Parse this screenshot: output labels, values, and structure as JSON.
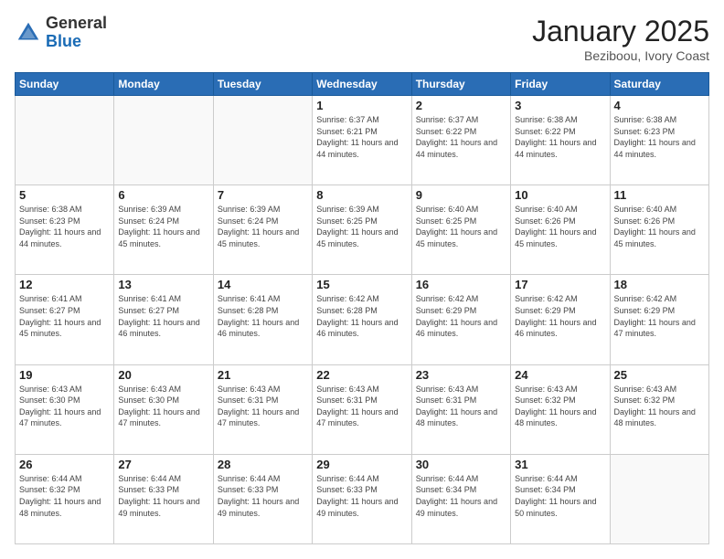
{
  "header": {
    "logo": {
      "general": "General",
      "blue": "Blue"
    },
    "title": "January 2025",
    "subtitle": "Beziboou, Ivory Coast"
  },
  "weekdays": [
    "Sunday",
    "Monday",
    "Tuesday",
    "Wednesday",
    "Thursday",
    "Friday",
    "Saturday"
  ],
  "weeks": [
    [
      {
        "day": "",
        "info": ""
      },
      {
        "day": "",
        "info": ""
      },
      {
        "day": "",
        "info": ""
      },
      {
        "day": "1",
        "info": "Sunrise: 6:37 AM\nSunset: 6:21 PM\nDaylight: 11 hours and 44 minutes."
      },
      {
        "day": "2",
        "info": "Sunrise: 6:37 AM\nSunset: 6:22 PM\nDaylight: 11 hours and 44 minutes."
      },
      {
        "day": "3",
        "info": "Sunrise: 6:38 AM\nSunset: 6:22 PM\nDaylight: 11 hours and 44 minutes."
      },
      {
        "day": "4",
        "info": "Sunrise: 6:38 AM\nSunset: 6:23 PM\nDaylight: 11 hours and 44 minutes."
      }
    ],
    [
      {
        "day": "5",
        "info": "Sunrise: 6:38 AM\nSunset: 6:23 PM\nDaylight: 11 hours and 44 minutes."
      },
      {
        "day": "6",
        "info": "Sunrise: 6:39 AM\nSunset: 6:24 PM\nDaylight: 11 hours and 45 minutes."
      },
      {
        "day": "7",
        "info": "Sunrise: 6:39 AM\nSunset: 6:24 PM\nDaylight: 11 hours and 45 minutes."
      },
      {
        "day": "8",
        "info": "Sunrise: 6:39 AM\nSunset: 6:25 PM\nDaylight: 11 hours and 45 minutes."
      },
      {
        "day": "9",
        "info": "Sunrise: 6:40 AM\nSunset: 6:25 PM\nDaylight: 11 hours and 45 minutes."
      },
      {
        "day": "10",
        "info": "Sunrise: 6:40 AM\nSunset: 6:26 PM\nDaylight: 11 hours and 45 minutes."
      },
      {
        "day": "11",
        "info": "Sunrise: 6:40 AM\nSunset: 6:26 PM\nDaylight: 11 hours and 45 minutes."
      }
    ],
    [
      {
        "day": "12",
        "info": "Sunrise: 6:41 AM\nSunset: 6:27 PM\nDaylight: 11 hours and 45 minutes."
      },
      {
        "day": "13",
        "info": "Sunrise: 6:41 AM\nSunset: 6:27 PM\nDaylight: 11 hours and 46 minutes."
      },
      {
        "day": "14",
        "info": "Sunrise: 6:41 AM\nSunset: 6:28 PM\nDaylight: 11 hours and 46 minutes."
      },
      {
        "day": "15",
        "info": "Sunrise: 6:42 AM\nSunset: 6:28 PM\nDaylight: 11 hours and 46 minutes."
      },
      {
        "day": "16",
        "info": "Sunrise: 6:42 AM\nSunset: 6:29 PM\nDaylight: 11 hours and 46 minutes."
      },
      {
        "day": "17",
        "info": "Sunrise: 6:42 AM\nSunset: 6:29 PM\nDaylight: 11 hours and 46 minutes."
      },
      {
        "day": "18",
        "info": "Sunrise: 6:42 AM\nSunset: 6:29 PM\nDaylight: 11 hours and 47 minutes."
      }
    ],
    [
      {
        "day": "19",
        "info": "Sunrise: 6:43 AM\nSunset: 6:30 PM\nDaylight: 11 hours and 47 minutes."
      },
      {
        "day": "20",
        "info": "Sunrise: 6:43 AM\nSunset: 6:30 PM\nDaylight: 11 hours and 47 minutes."
      },
      {
        "day": "21",
        "info": "Sunrise: 6:43 AM\nSunset: 6:31 PM\nDaylight: 11 hours and 47 minutes."
      },
      {
        "day": "22",
        "info": "Sunrise: 6:43 AM\nSunset: 6:31 PM\nDaylight: 11 hours and 47 minutes."
      },
      {
        "day": "23",
        "info": "Sunrise: 6:43 AM\nSunset: 6:31 PM\nDaylight: 11 hours and 48 minutes."
      },
      {
        "day": "24",
        "info": "Sunrise: 6:43 AM\nSunset: 6:32 PM\nDaylight: 11 hours and 48 minutes."
      },
      {
        "day": "25",
        "info": "Sunrise: 6:43 AM\nSunset: 6:32 PM\nDaylight: 11 hours and 48 minutes."
      }
    ],
    [
      {
        "day": "26",
        "info": "Sunrise: 6:44 AM\nSunset: 6:32 PM\nDaylight: 11 hours and 48 minutes."
      },
      {
        "day": "27",
        "info": "Sunrise: 6:44 AM\nSunset: 6:33 PM\nDaylight: 11 hours and 49 minutes."
      },
      {
        "day": "28",
        "info": "Sunrise: 6:44 AM\nSunset: 6:33 PM\nDaylight: 11 hours and 49 minutes."
      },
      {
        "day": "29",
        "info": "Sunrise: 6:44 AM\nSunset: 6:33 PM\nDaylight: 11 hours and 49 minutes."
      },
      {
        "day": "30",
        "info": "Sunrise: 6:44 AM\nSunset: 6:34 PM\nDaylight: 11 hours and 49 minutes."
      },
      {
        "day": "31",
        "info": "Sunrise: 6:44 AM\nSunset: 6:34 PM\nDaylight: 11 hours and 50 minutes."
      },
      {
        "day": "",
        "info": ""
      }
    ]
  ]
}
